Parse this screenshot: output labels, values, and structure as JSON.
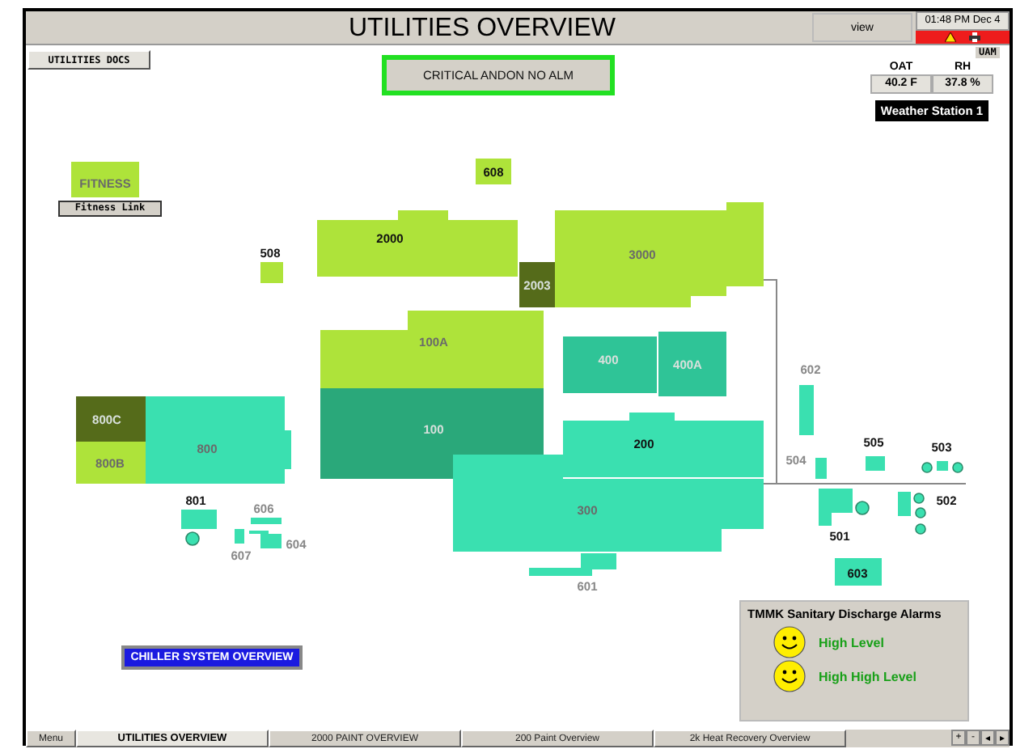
{
  "header": {
    "title": "UTILITIES OVERVIEW",
    "view_button": "view",
    "clock": "01:48 PM Dec 4",
    "user": "UAM"
  },
  "docs_button": "UTILITIES DOCS",
  "andon": {
    "label": "CRITICAL ANDON NO ALM",
    "alarm": false
  },
  "weather": {
    "readings": [
      {
        "label": "OAT",
        "value": "40.2 F"
      },
      {
        "label": "RH",
        "value": "37.8 %"
      }
    ],
    "station": "Weather Station 1"
  },
  "fitness_link": "Fitness Link",
  "chiller_button": "CHILLER SYSTEM OVERVIEW",
  "buildings": [
    {
      "label": "FITNESS",
      "color": "#aee33a",
      "dim": true
    },
    {
      "label": "608",
      "color": "#aee33a",
      "dim": false
    },
    {
      "label": "2000",
      "color": "#aee33a",
      "dim": false
    },
    {
      "label": "508",
      "color": "#aee33a",
      "dim": false
    },
    {
      "label": "2003",
      "color": "#556b1a",
      "dim": true
    },
    {
      "label": "3000",
      "color": "#aee33a",
      "dim": true
    },
    {
      "label": "100A",
      "color": "#aee33a",
      "dim": true
    },
    {
      "label": "100",
      "color": "#2aa87a",
      "dim": true
    },
    {
      "label": "400",
      "color": "#2fc497",
      "dim": true
    },
    {
      "label": "400A",
      "color": "#2fc497",
      "dim": true
    },
    {
      "label": "200",
      "color": "#3ae0b0",
      "dim": false
    },
    {
      "label": "300",
      "color": "#3ae0b0",
      "dim": true
    },
    {
      "label": "601",
      "color": "#3ae0b0",
      "dim": true
    },
    {
      "label": "800C",
      "color": "#556b1a",
      "dim": true
    },
    {
      "label": "800B",
      "color": "#aee33a",
      "dim": true
    },
    {
      "label": "800",
      "color": "#3ae0b0",
      "dim": true
    },
    {
      "label": "801",
      "color": "#3ae0b0",
      "dim": false
    },
    {
      "label": "606",
      "color": "#3ae0b0",
      "dim": true
    },
    {
      "label": "604",
      "color": "#3ae0b0",
      "dim": true
    },
    {
      "label": "607",
      "color": "#3ae0b0",
      "dim": true
    },
    {
      "label": "602",
      "color": "#3ae0b0",
      "dim": true
    },
    {
      "label": "504",
      "color": "#3ae0b0",
      "dim": true
    },
    {
      "label": "505",
      "color": "#3ae0b0",
      "dim": false
    },
    {
      "label": "503",
      "color": "#3ae0b0",
      "dim": false
    },
    {
      "label": "502",
      "color": "#3ae0b0",
      "dim": false
    },
    {
      "label": "501",
      "color": "#3ae0b0",
      "dim": false
    },
    {
      "label": "603",
      "color": "#3ae0b0",
      "dim": false
    }
  ],
  "alarms": {
    "title": "TMMK Sanitary Discharge Alarms",
    "items": [
      {
        "label": "High Level",
        "active": false
      },
      {
        "label": "High High Level",
        "active": false
      }
    ]
  },
  "tabs": [
    {
      "label": "Menu",
      "selected": false
    },
    {
      "label": "UTILITIES OVERVIEW",
      "selected": true
    },
    {
      "label": "2000 PAINT OVERVIEW",
      "selected": false
    },
    {
      "label": "200 Paint Overview",
      "selected": false
    },
    {
      "label": "2k Heat Recovery Overview",
      "selected": false
    }
  ],
  "scroll_buttons": [
    "+",
    "-",
    "◂",
    "▸"
  ]
}
